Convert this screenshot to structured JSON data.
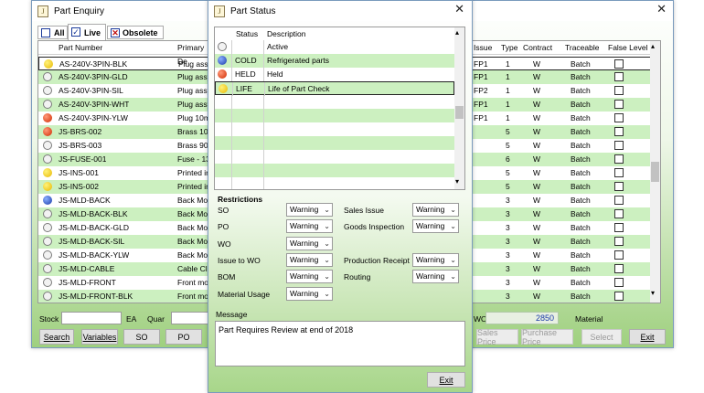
{
  "back_window": {
    "title": "Part Enquiry",
    "tabs": {
      "all": "All",
      "live": "Live",
      "obsolete": "Obsolete"
    },
    "columns": {
      "part_number": "Part Number",
      "primary_desc": "Primary De"
    },
    "rows": [
      {
        "status": "yellow",
        "part": "AS-240V-3PIN-BLK",
        "desc": "Plug assy"
      },
      {
        "status": "none",
        "part": "AS-240V-3PIN-GLD",
        "desc": "Plug assy"
      },
      {
        "status": "none",
        "part": "AS-240V-3PIN-SIL",
        "desc": "Plug assy"
      },
      {
        "status": "none",
        "part": "AS-240V-3PIN-WHT",
        "desc": "Plug assy"
      },
      {
        "status": "red",
        "part": "AS-240V-3PIN-YLW",
        "desc": "Plug 10m"
      },
      {
        "status": "red",
        "part": "JS-BRS-002",
        "desc": "Brass 10m"
      },
      {
        "status": "none",
        "part": "JS-BRS-003",
        "desc": "Brass 90m"
      },
      {
        "status": "none",
        "part": "JS-FUSE-001",
        "desc": "Fuse - 13"
      },
      {
        "status": "yellow",
        "part": "JS-INS-001",
        "desc": "Printed ins"
      },
      {
        "status": "yellow",
        "part": "JS-INS-002",
        "desc": "Printed ins"
      },
      {
        "status": "blue",
        "part": "JS-MLD-BACK",
        "desc": "Back Moul"
      },
      {
        "status": "none",
        "part": "JS-MLD-BACK-BLK",
        "desc": "Back Moul"
      },
      {
        "status": "none",
        "part": "JS-MLD-BACK-GLD",
        "desc": "Back Moul"
      },
      {
        "status": "none",
        "part": "JS-MLD-BACK-SIL",
        "desc": "Back Moul"
      },
      {
        "status": "none",
        "part": "JS-MLD-BACK-YLW",
        "desc": "Back Moul"
      },
      {
        "status": "none",
        "part": "JS-MLD-CABLE",
        "desc": "Cable Clar"
      },
      {
        "status": "none",
        "part": "JS-MLD-FRONT",
        "desc": "Front mou"
      },
      {
        "status": "none",
        "part": "JS-MLD-FRONT-BLK",
        "desc": "Front mou"
      }
    ],
    "right_columns": {
      "issue": "Issue",
      "type": "Type",
      "contract": "Contract",
      "traceable": "Traceable",
      "false_level": "False Level"
    },
    "right_rows": [
      {
        "issue": "FP1",
        "type": "1",
        "contract": "W",
        "traceable": "Batch"
      },
      {
        "issue": "FP1",
        "type": "1",
        "contract": "W",
        "traceable": "Batch"
      },
      {
        "issue": "FP2",
        "type": "1",
        "contract": "W",
        "traceable": "Batch"
      },
      {
        "issue": "FP1",
        "type": "1",
        "contract": "W",
        "traceable": "Batch"
      },
      {
        "issue": "FP1",
        "type": "1",
        "contract": "W",
        "traceable": "Batch"
      },
      {
        "issue": "",
        "type": "5",
        "contract": "W",
        "traceable": "Batch"
      },
      {
        "issue": "",
        "type": "5",
        "contract": "W",
        "traceable": "Batch"
      },
      {
        "issue": "",
        "type": "6",
        "contract": "W",
        "traceable": "Batch"
      },
      {
        "issue": "",
        "type": "5",
        "contract": "W",
        "traceable": "Batch"
      },
      {
        "issue": "",
        "type": "5",
        "contract": "W",
        "traceable": "Batch"
      },
      {
        "issue": "",
        "type": "3",
        "contract": "W",
        "traceable": "Batch"
      },
      {
        "issue": "",
        "type": "3",
        "contract": "W",
        "traceable": "Batch"
      },
      {
        "issue": "",
        "type": "3",
        "contract": "W",
        "traceable": "Batch"
      },
      {
        "issue": "",
        "type": "3",
        "contract": "W",
        "traceable": "Batch"
      },
      {
        "issue": "",
        "type": "3",
        "contract": "W",
        "traceable": "Batch"
      },
      {
        "issue": "",
        "type": "3",
        "contract": "W",
        "traceable": "Batch"
      },
      {
        "issue": "",
        "type": "3",
        "contract": "W",
        "traceable": "Batch"
      },
      {
        "issue": "",
        "type": "3",
        "contract": "W",
        "traceable": "Batch"
      }
    ],
    "stock_label": "Stock",
    "stock_unit": "EA",
    "quar_label": "Quar",
    "wo_label": "WO",
    "wo_value": "2850",
    "material_label": "Material",
    "buttons": {
      "search": "Search",
      "variables": "Variables",
      "so": "SO",
      "po": "PO",
      "sales_price": "Sales Price",
      "purchase_price": "Purchase Price",
      "select": "Select",
      "exit": "Exit"
    }
  },
  "dialog": {
    "title": "Part Status",
    "columns": {
      "status": "Status",
      "description": "Description"
    },
    "statuses": [
      {
        "dot": "none",
        "code": "",
        "desc": "Active"
      },
      {
        "dot": "blue",
        "code": "COLD",
        "desc": "Refrigerated parts"
      },
      {
        "dot": "red",
        "code": "HELD",
        "desc": "Held"
      },
      {
        "dot": "yellow",
        "code": "LIFE",
        "desc": "Life of Part Check"
      }
    ],
    "restrictions_title": "Restrictions",
    "restrictions_left": [
      {
        "label": "SO",
        "value": "Warning"
      },
      {
        "label": "PO",
        "value": "Warning"
      },
      {
        "label": "WO",
        "value": "Warning"
      },
      {
        "label": "Issue to WO",
        "value": "Warning"
      },
      {
        "label": "BOM",
        "value": "Warning"
      },
      {
        "label": "Material Usage",
        "value": "Warning"
      }
    ],
    "restrictions_right": [
      {
        "label": "Sales Issue",
        "value": "Warning"
      },
      {
        "label": "Goods Inspection",
        "value": "Warning"
      },
      {
        "label": "Production Receipt",
        "value": "Warning"
      },
      {
        "label": "Routing",
        "value": "Warning"
      }
    ],
    "message_label": "Message",
    "message_text": "Part Requires Review at end of 2018",
    "exit_label": "Exit"
  }
}
